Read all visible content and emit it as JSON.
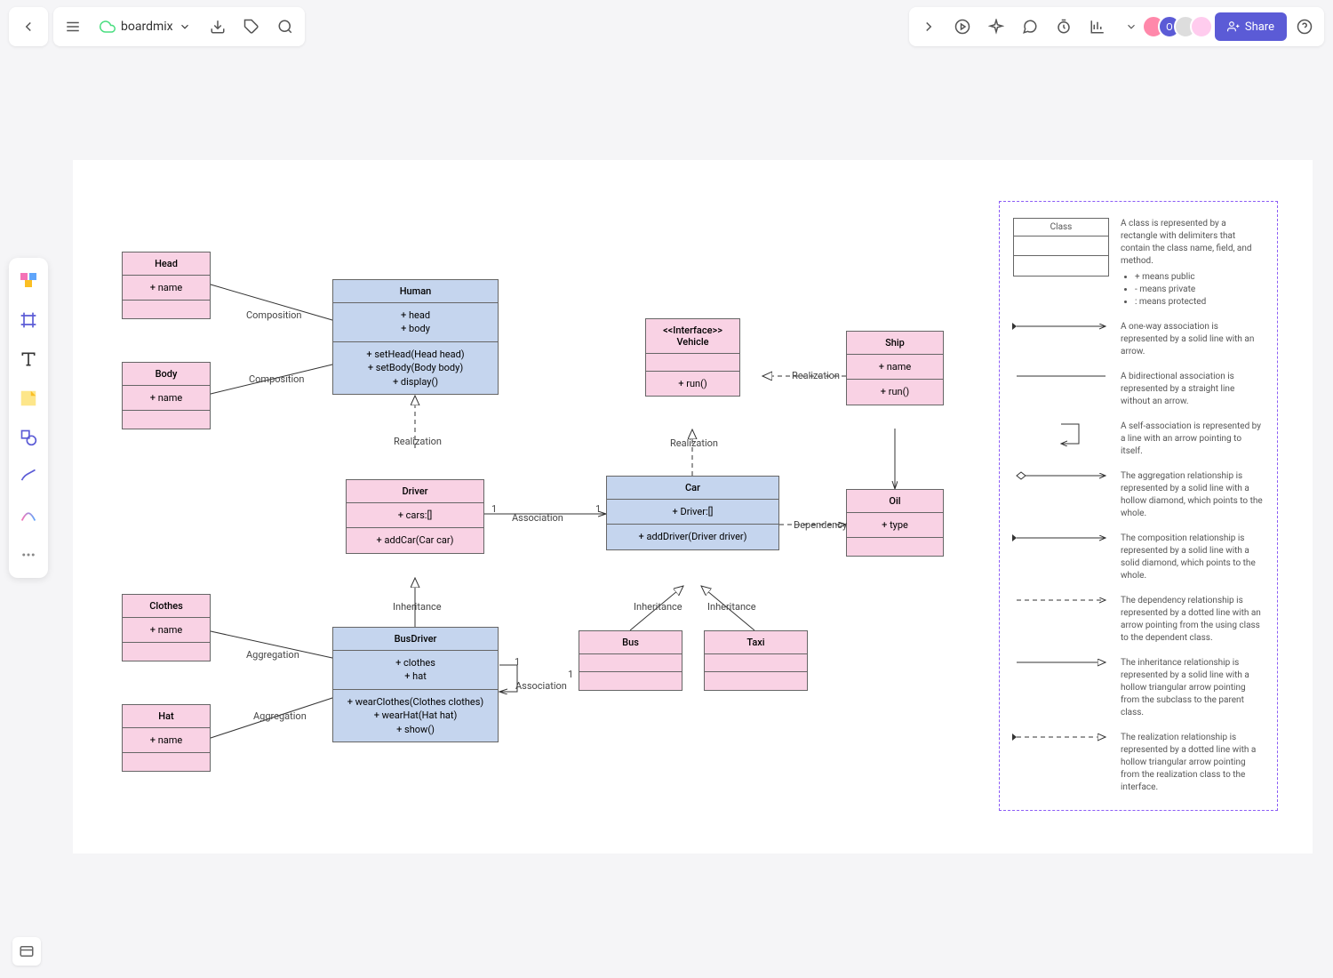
{
  "app": {
    "title": "boardmix"
  },
  "toolbar": {
    "share": "Share"
  },
  "classes": {
    "head": {
      "name": "Head",
      "attr1": "+ name"
    },
    "body": {
      "name": "Body",
      "attr1": "+ name"
    },
    "human": {
      "name": "Human",
      "attr1": "+ head",
      "attr2": "+ body",
      "op1": "+ setHead(Head head)",
      "op2": "+ setBody(Body body)",
      "op3": "+ display()"
    },
    "driver": {
      "name": "Driver",
      "attr1": "+ cars:[]",
      "op1": "+ addCar(Car car)"
    },
    "busdriver": {
      "name": "BusDriver",
      "attr1": "+ clothes",
      "attr2": "+ hat",
      "op1": "+ wearClothes(Clothes clothes)",
      "op2": "+ wearHat(Hat hat)",
      "op3": "+ show()"
    },
    "clothes": {
      "name": "Clothes",
      "attr1": "+ name"
    },
    "hat": {
      "name": "Hat",
      "attr1": "+ name"
    },
    "vehicle": {
      "stereo": "<<Interface>>",
      "name": "Vehicle",
      "op1": "+ run()"
    },
    "car": {
      "name": "Car",
      "attr1": "+ Driver:[]",
      "op1": "+ addDriver(Driver driver)"
    },
    "bus": {
      "name": "Bus"
    },
    "taxi": {
      "name": "Taxi"
    },
    "ship": {
      "name": "Ship",
      "attr1": "+ name",
      "op1": "+ run()"
    },
    "oil": {
      "name": "Oil",
      "attr1": "+ type"
    }
  },
  "labels": {
    "composition1": "Composition",
    "composition2": "Composition",
    "realization1": "Realization",
    "realization2": "Realization",
    "association1": "Association",
    "association2": "Association",
    "inheritance1": "Inheritance",
    "inheritance2": "Inheritance",
    "inheritance3": "Inheritance",
    "aggregation1": "Aggregation",
    "aggregation2": "Aggregation",
    "dependency": "Dependency",
    "one1": "1",
    "one2": "1",
    "one3": "1",
    "one4": "1"
  },
  "legend": {
    "class_title": "Class",
    "class_desc": "A class is represented by a rectangle with delimiters that contain the class name, field, and method.",
    "b1": "+ means public",
    "b2": "- means private",
    "b3": ": means protected",
    "assoc": "A one-way association is represented by a solid line with an arrow.",
    "biassoc": "A bidirectional association is represented by a straight line without an arrow.",
    "self": "A self-association is represented by a line with an arrow pointing to itself.",
    "agg": "The aggregation relationship is represented by a solid line with a hollow diamond, which points to the whole.",
    "comp": "The composition relationship is represented by a solid line with a solid diamond, which points to the whole.",
    "dep": "The dependency relationship is represented by a dotted line with an arrow pointing from the using class to the dependent class.",
    "inh": "The inheritance relationship is represented by a solid line with a hollow triangular arrow pointing from the subclass to the parent class.",
    "real": "The realization relationship is represented by a dotted line with a hollow triangular arrow pointing from the realization class to the interface."
  }
}
